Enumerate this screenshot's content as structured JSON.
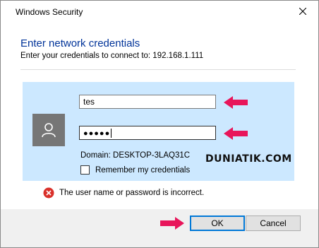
{
  "window": {
    "title": "Windows Security"
  },
  "dialog": {
    "heading": "Enter network credentials",
    "subtitle": "Enter your credentials to connect to: 192.168.1.111"
  },
  "form": {
    "username_value": "tes",
    "password_masked": "●●●●●",
    "domain_text": "Domain: DESKTOP-3LAQ31C",
    "remember_label": "Remember my credentials",
    "remember_checked": false
  },
  "error": {
    "message": "The user name or password is incorrect."
  },
  "buttons": {
    "ok_label": "OK",
    "cancel_label": "Cancel"
  },
  "watermark": "DUNIATIK.COM",
  "colors": {
    "accent_blue": "#003399",
    "panel_bg": "#cce8ff",
    "arrow_pink": "#e8155a",
    "error_red": "#d9302a"
  },
  "icons": [
    "close-icon",
    "user-icon",
    "error-icon",
    "arrow-icon"
  ]
}
